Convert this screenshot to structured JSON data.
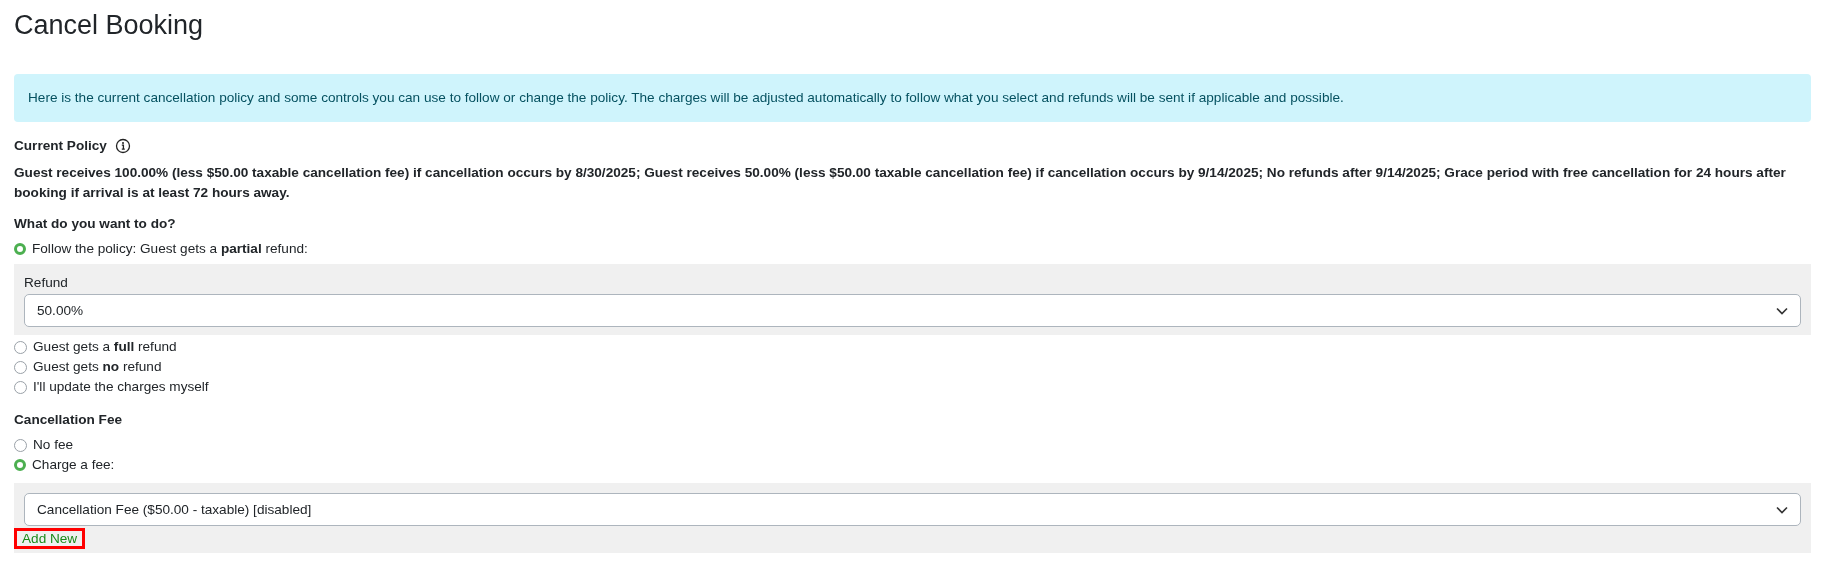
{
  "title": "Cancel Booking",
  "notice": "Here is the current cancellation policy and some controls you can use to follow or change the policy. The charges will be adjusted automatically to follow what you select and refunds will be sent if applicable and possible.",
  "policy": {
    "label": "Current Policy",
    "text": "Guest receives 100.00% (less $50.00 taxable cancellation fee) if cancellation occurs by 8/30/2025; Guest receives 50.00% (less $50.00 taxable cancellation fee) if cancellation occurs by 9/14/2025; No refunds after 9/14/2025; Grace period with free cancellation for 24 hours after booking if arrival is at least 72 hours away."
  },
  "action": {
    "heading": "What do you want to do?",
    "options": [
      {
        "label": "Follow the policy: Guest gets a **partial** refund:",
        "selected": true,
        "panel": {
          "label": "Refund",
          "value": "50.00%"
        }
      },
      {
        "label": "Guest gets a **full** refund",
        "selected": false
      },
      {
        "label": "Guest gets **no** refund",
        "selected": false
      },
      {
        "label": "I'll update the charges myself",
        "selected": false
      }
    ]
  },
  "fee": {
    "heading": "Cancellation Fee",
    "options": [
      {
        "label": "No fee",
        "selected": false
      },
      {
        "label": "Charge a fee:",
        "selected": true,
        "panel": {
          "value": "Cancellation Fee ($50.00 - taxable) [disabled]",
          "link": {
            "label": "Add New",
            "highlighted": true
          }
        }
      }
    ]
  }
}
